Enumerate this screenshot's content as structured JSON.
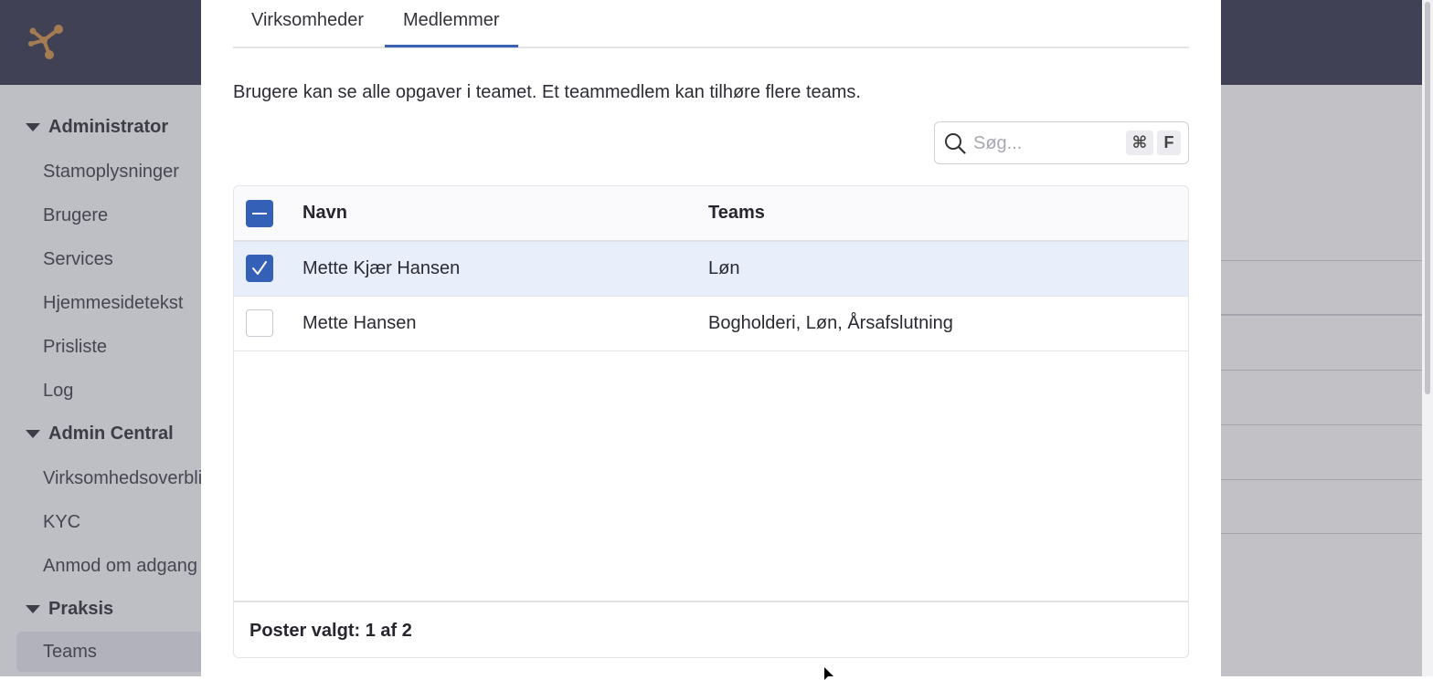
{
  "sidebar": {
    "groups": [
      {
        "label": "Administrator",
        "items": [
          "Stamoplysninger",
          "Brugere",
          "Services",
          "Hjemmesidetekst",
          "Prisliste",
          "Log"
        ]
      },
      {
        "label": "Admin Central",
        "items": [
          "Virksomhedsoverblik",
          "KYC",
          "Anmod om adgang"
        ]
      },
      {
        "label": "Praksis",
        "items": [
          "Teams"
        ],
        "active_item": "Teams"
      }
    ]
  },
  "modal": {
    "tabs": [
      {
        "label": "Virksomheder",
        "active": false
      },
      {
        "label": "Medlemmer",
        "active": true
      }
    ],
    "description": "Brugere kan se alle opgaver i teamet. Et teammedlem kan tilhøre flere teams.",
    "search": {
      "placeholder": "Søg...",
      "shortcut": [
        "⌘",
        "F"
      ]
    },
    "table": {
      "columns": [
        "Navn",
        "Teams"
      ],
      "header_checkbox_state": "indeterminate",
      "rows": [
        {
          "name": "Mette Kjær Hansen",
          "teams": "Løn",
          "selected": true
        },
        {
          "name": "Mette Hansen",
          "teams": "Bogholderi, Løn, Årsafslutning",
          "selected": false
        }
      ],
      "footer": "Poster valgt: 1 af 2"
    }
  },
  "colors": {
    "topbar": "#2b2b45",
    "accent": "#3560b7",
    "logo": "#d08a3c",
    "selected_row": "#e8effb"
  }
}
